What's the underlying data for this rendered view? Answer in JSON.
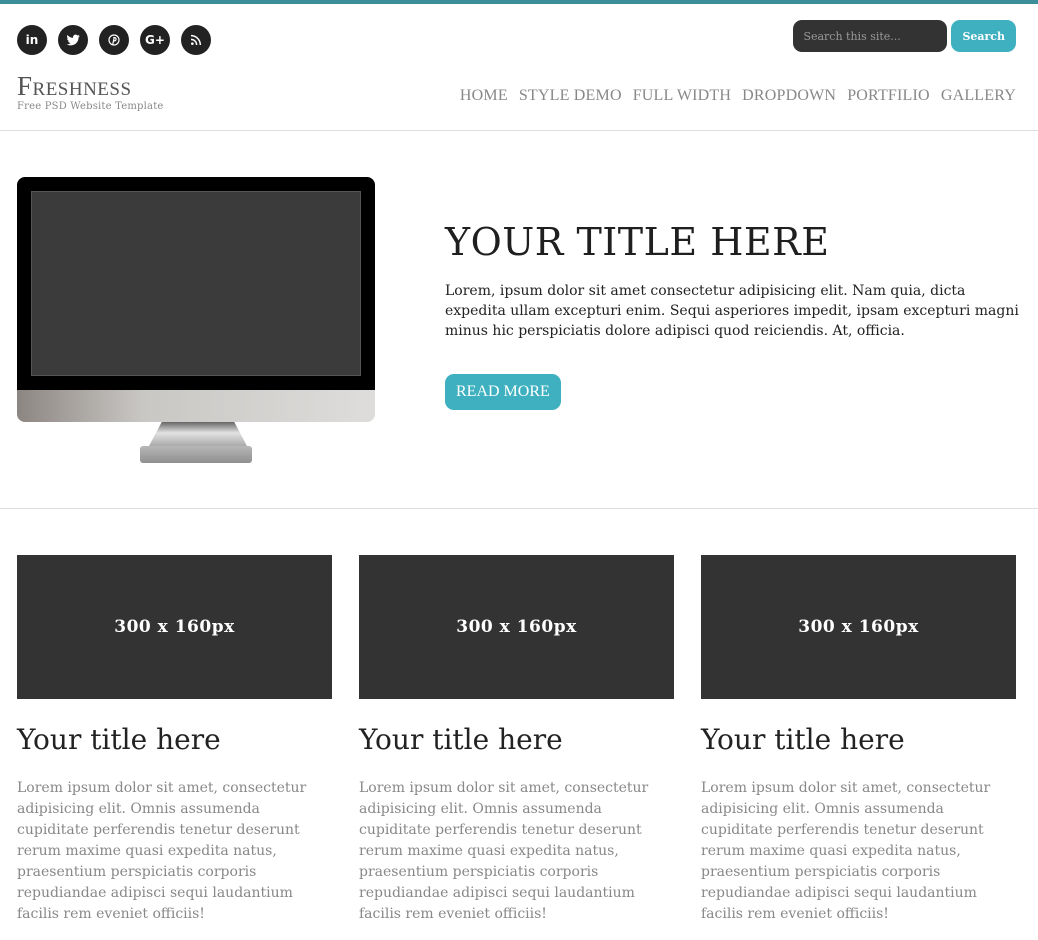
{
  "social": {
    "icons": [
      "linkedin-icon",
      "twitter-icon",
      "pinterest-icon",
      "google-plus-icon",
      "rss-icon"
    ],
    "linkedin_glyph": "in",
    "googleplus_glyph": "G+"
  },
  "search": {
    "placeholder": "Search this site...",
    "button_label": "Search"
  },
  "brand": {
    "title": "Freshness",
    "subtitle": "Free PSD Website Template"
  },
  "nav": {
    "items": [
      "HOME",
      "STYLE DEMO",
      "FULL WIDTH",
      "DROPDOWN",
      "PORTFILIO",
      "GALLERY"
    ]
  },
  "hero": {
    "title": "YOUR TITLE HERE",
    "body": "Lorem, ipsum dolor sit amet consectetur adipisicing elit. Nam quia, dicta expedita ullam excepturi enim. Sequi asperiores impedit, ipsam excepturi magni minus hic perspiciatis dolore adipisci quod reiciendis. At, officia.",
    "button_label": "READ MORE"
  },
  "cards": [
    {
      "image_label": "300 x 160px",
      "title": "Your title here",
      "body": "Lorem ipsum dolor sit amet, consectetur adipisicing elit. Omnis assumenda cupiditate perferendis tenetur deserunt rerum maxime quasi expedita natus, praesentium perspiciatis corporis repudiandae adipisci sequi laudantium facilis rem eveniet officiis!"
    },
    {
      "image_label": "300 x 160px",
      "title": "Your title here",
      "body": "Lorem ipsum dolor sit amet, consectetur adipisicing elit. Omnis assumenda cupiditate perferendis tenetur deserunt rerum maxime quasi expedita natus, praesentium perspiciatis corporis repudiandae adipisci sequi laudantium facilis rem eveniet officiis!"
    },
    {
      "image_label": "300 x 160px",
      "title": "Your title here",
      "body": "Lorem ipsum dolor sit amet, consectetur adipisicing elit. Omnis assumenda cupiditate perferendis tenetur deserunt rerum maxime quasi expedita natus, praesentium perspiciatis corporis repudiandae adipisci sequi laudantium facilis rem eveniet officiis!"
    }
  ],
  "colors": {
    "accent": "#3eb0bf",
    "top_bar": "#3b8e9a",
    "dark": "#333333"
  }
}
